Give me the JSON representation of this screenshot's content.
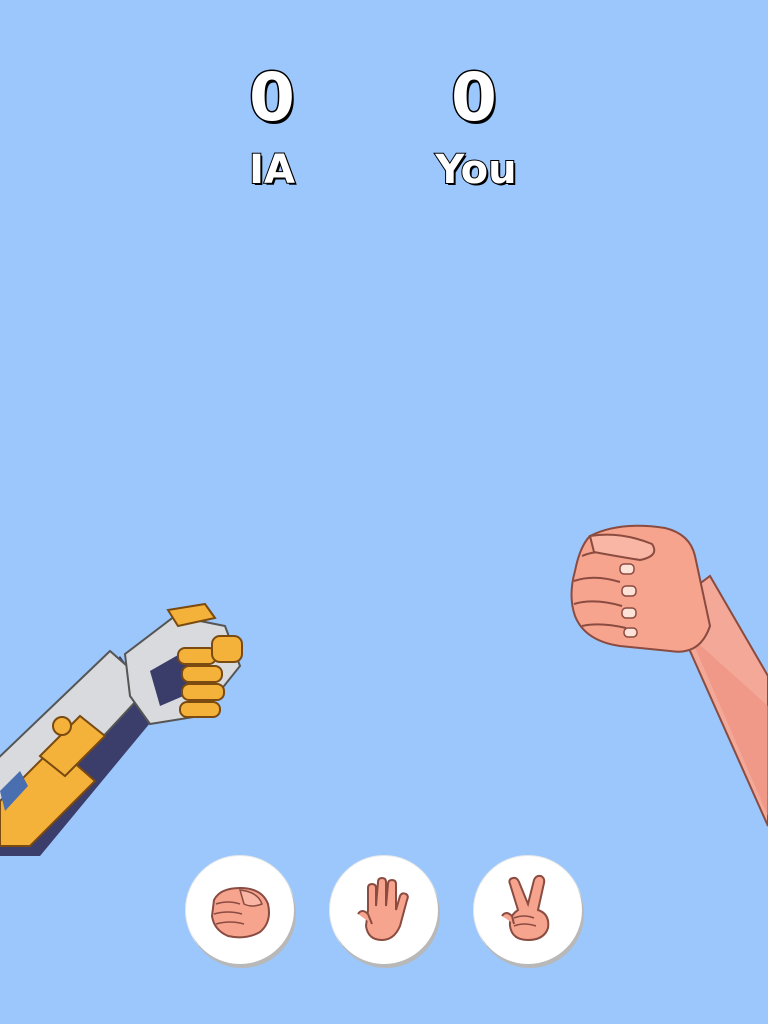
{
  "scoreboard": {
    "ai_score": "0",
    "player_score": "0",
    "ai_label": "IA",
    "player_label": "You"
  },
  "arena": {
    "ai_hand": "robot-fist",
    "player_hand": "human-fist"
  },
  "choices": [
    {
      "id": "rock",
      "icon": "rock-hand-icon"
    },
    {
      "id": "paper",
      "icon": "paper-hand-icon"
    },
    {
      "id": "scissors",
      "icon": "scissors-hand-icon"
    }
  ],
  "colors": {
    "background": "#9cc7fc",
    "skin": "#f7a48f",
    "robot_gold": "#f4b23a",
    "robot_silver": "#d8dadd"
  }
}
